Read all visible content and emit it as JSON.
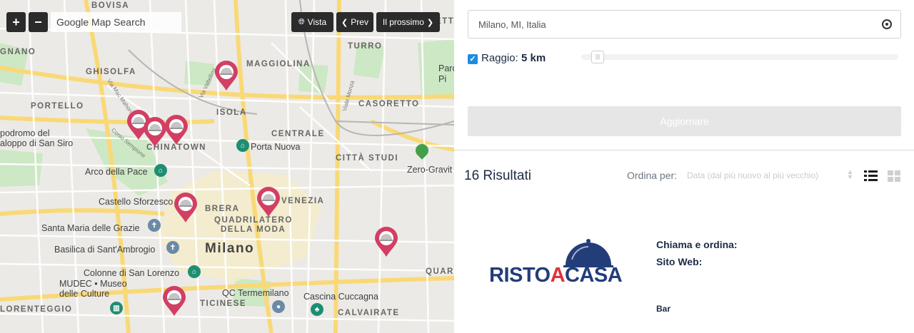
{
  "map": {
    "zoom_in_label": "+",
    "zoom_out_label": "−",
    "search_placeholder": "Google Map Search",
    "view_label": "Vista",
    "prev_label": "Prev",
    "next_label": "Il prossimo",
    "city_label": "Milano",
    "districts": [
      "BOVISA",
      "MAGGIOLINA",
      "TURRO",
      "GHISOLFA",
      "PORTELLO",
      "ISOLA",
      "CASORETTO",
      "CENTRALE",
      "CHINATOWN",
      "CITTÀ STUDI",
      "BRERA",
      "VENEZIA",
      "QUADRILATERO",
      "DELLA MODA",
      "QUART",
      "TICINESE",
      "CALVAIRATE",
      "LORENTEGGIO",
      "GNANO",
      "ETTA"
    ],
    "pois": [
      "Porta Nuova",
      "Arco della Pace",
      "Castello Sforzesco",
      "Santa Maria delle Grazie",
      "Basilica di Sant'Ambrogio",
      "Colonne di San Lorenzo",
      "MUDEC • Museo",
      "delle Culture",
      "QC Termemilano",
      "Cascina Cuccagna",
      "Zero-Gravit",
      "podromo del",
      "aloppo di San Siro",
      "Parc",
      "Pi"
    ],
    "streets": [
      "Via Valtellina",
      "Viale Monza",
      "Via Mac Mahon",
      "Corso Sempione"
    ]
  },
  "panel": {
    "location_value": "Milano, MI, Italia",
    "radius_label": "Raggio:",
    "radius_value": "5 km",
    "update_label": "Aggiornare",
    "results_count": "16 Risultati",
    "sort_label": "Ordina per:",
    "sort_value": "Data (dal più nuovo al più vecchio)",
    "listing": {
      "logo_part1": "RISTO",
      "logo_part2": "A",
      "logo_part3": "CASA",
      "call_label": "Chiama e ordina:",
      "site_label": "Sito Web:",
      "category": "Bar"
    }
  },
  "colors": {
    "pin": "#d23f64",
    "accent_blue": "#1d8ce0",
    "text_dark": "#1c2b44",
    "logo_blue": "#233d7a",
    "logo_red": "#e0313a"
  }
}
